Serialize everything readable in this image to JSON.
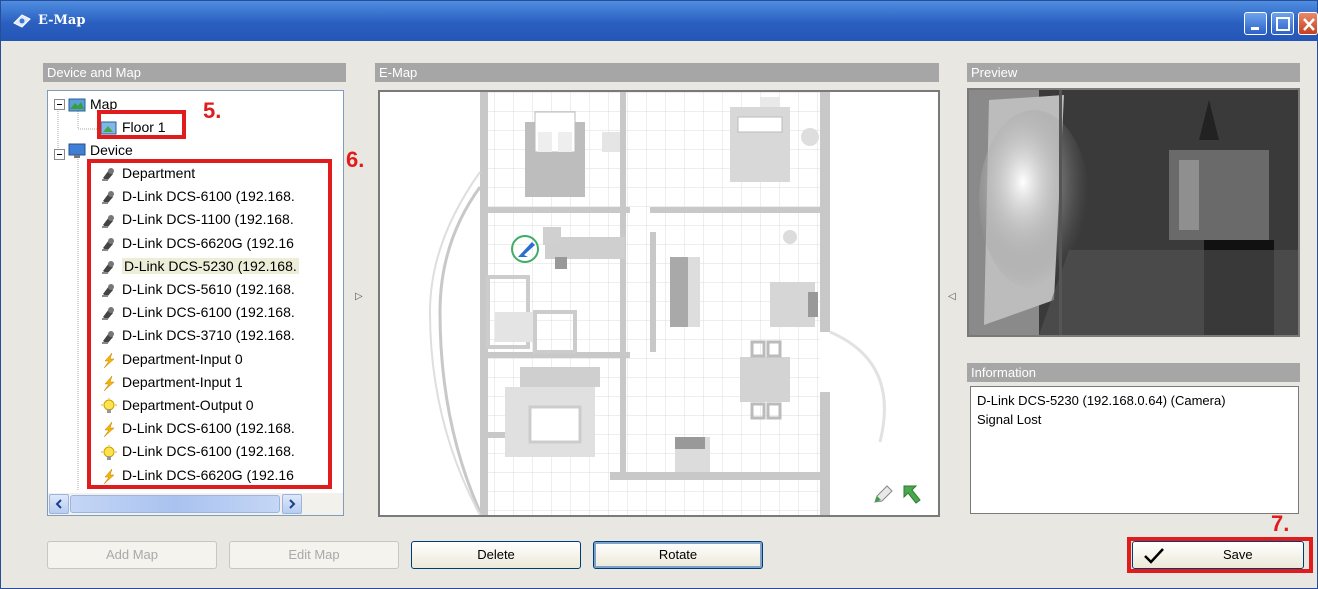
{
  "window": {
    "title": "E-Map"
  },
  "panels": {
    "device_and_map": "Device and Map",
    "emap": "E-Map",
    "preview": "Preview",
    "information": "Information"
  },
  "tree": {
    "map_root": "Map",
    "floor": "Floor 1",
    "device_root": "Device",
    "items": [
      {
        "label": "Department",
        "icon": "camera-icon"
      },
      {
        "label": "D-Link DCS-6100 (192.168.",
        "icon": "camera-icon"
      },
      {
        "label": "D-Link DCS-1100 (192.168.",
        "icon": "camera-icon"
      },
      {
        "label": "D-Link DCS-6620G (192.16",
        "icon": "camera-icon"
      },
      {
        "label": "D-Link DCS-5230 (192.168.",
        "icon": "camera-icon"
      },
      {
        "label": "D-Link DCS-5610 (192.168.",
        "icon": "camera-icon"
      },
      {
        "label": "D-Link DCS-6100 (192.168.",
        "icon": "camera-icon"
      },
      {
        "label": "D-Link DCS-3710 (192.168.",
        "icon": "camera-icon"
      },
      {
        "label": "Department-Input 0",
        "icon": "input-lightning-icon"
      },
      {
        "label": "Department-Input 1",
        "icon": "input-lightning-icon"
      },
      {
        "label": "Department-Output 0",
        "icon": "output-bulb-icon"
      },
      {
        "label": "D-Link DCS-6100 (192.168.",
        "icon": "input-lightning-icon"
      },
      {
        "label": "D-Link DCS-6100 (192.168.",
        "icon": "output-bulb-icon"
      },
      {
        "label": "D-Link DCS-6620G (192.16",
        "icon": "input-lightning-icon"
      }
    ],
    "selected_index": 4
  },
  "information": {
    "line1": "D-Link DCS-5230 (192.168.0.64) (Camera)",
    "line2": "Signal Lost"
  },
  "buttons": {
    "add_map": "Add Map",
    "edit_map": "Edit Map",
    "delete": "Delete",
    "rotate": "Rotate",
    "save": "Save"
  },
  "annotations": {
    "step5": "5.",
    "step6": "6.",
    "step7": "7."
  },
  "scroll": {
    "hscroll_left": "◀",
    "hscroll_right": "▶",
    "hscroll_grip": "|||"
  },
  "colors": {
    "title_bar": "#2a5fc0",
    "annotation_red": "#e01c1c",
    "panel_header": "#a6a6a6"
  }
}
